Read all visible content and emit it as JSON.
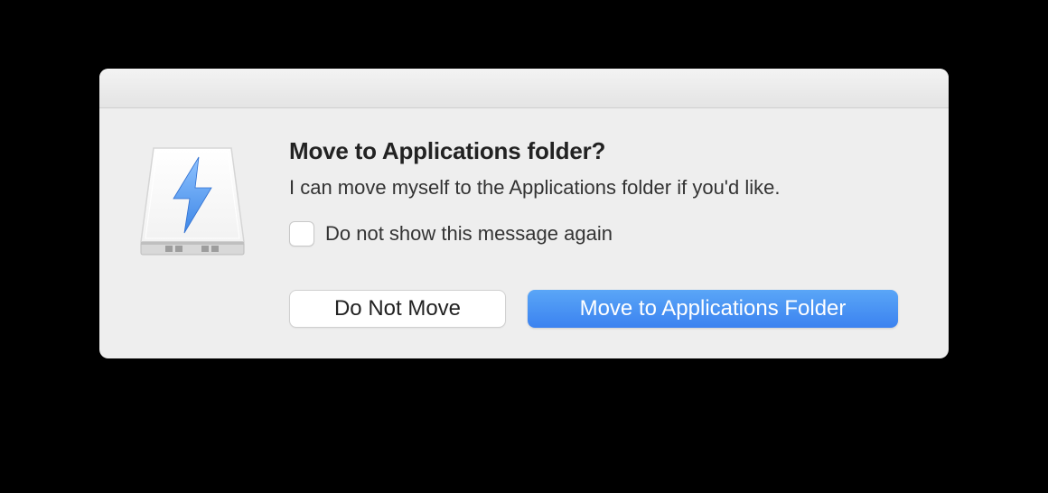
{
  "dialog": {
    "title": "Move to Applications folder?",
    "message": "I can move myself to the Applications folder if you'd like.",
    "checkbox_label": "Do not show this message again",
    "button_secondary": "Do Not Move",
    "button_primary": "Move to Applications Folder"
  }
}
